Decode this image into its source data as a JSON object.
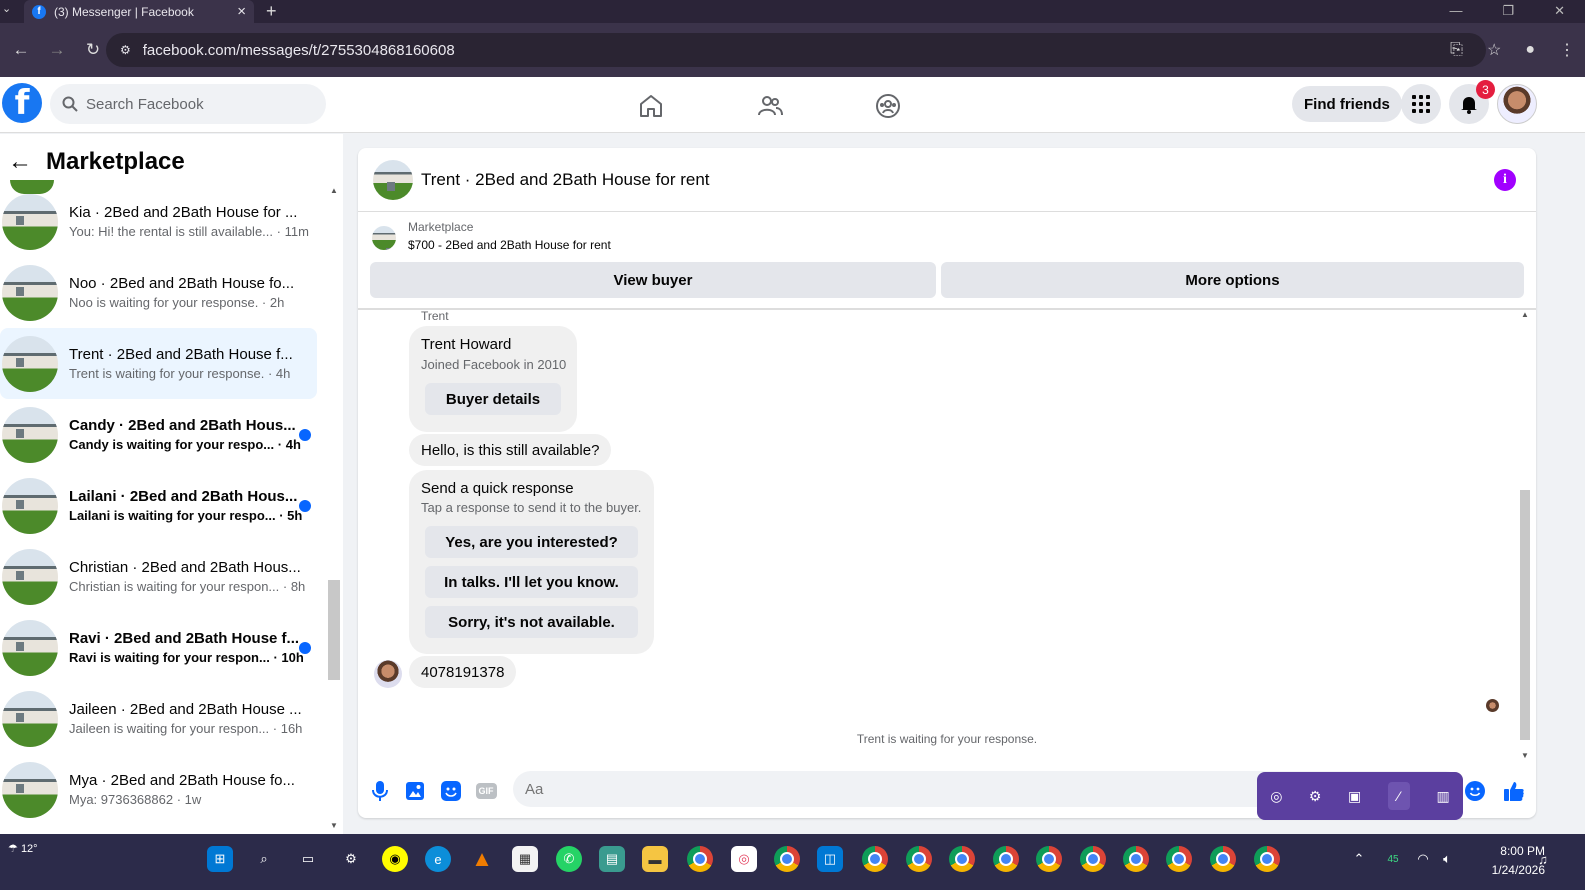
{
  "browser": {
    "tab_title": "(3) Messenger | Facebook",
    "url": "facebook.com/messages/t/2755304868160608"
  },
  "header": {
    "search_placeholder": "Search Facebook",
    "find_friends": "Find friends",
    "notification_count": "3"
  },
  "sidebar": {
    "title": "Marketplace",
    "conversations": [
      {
        "name": "Kia · 2Bed and 2Bath House for ...",
        "preview": "You: Hi! the rental is still available...",
        "time": "11m",
        "unread": false,
        "active": false
      },
      {
        "name": "Noo · 2Bed and 2Bath House fo...",
        "preview": "Noo is waiting for your response.",
        "time": "2h",
        "unread": false,
        "active": false
      },
      {
        "name": "Trent · 2Bed and 2Bath House f...",
        "preview": "Trent is waiting for your response.",
        "time": "4h",
        "unread": false,
        "active": true
      },
      {
        "name": "Candy · 2Bed and 2Bath Hous...",
        "preview": "Candy is waiting for your respo...",
        "time": "4h",
        "unread": true,
        "active": false
      },
      {
        "name": "Lailani · 2Bed and 2Bath Hous...",
        "preview": "Lailani is waiting for your respo...",
        "time": "5h",
        "unread": true,
        "active": false
      },
      {
        "name": "Christian · 2Bed and 2Bath Hous...",
        "preview": "Christian is waiting for your respon...",
        "time": "8h",
        "unread": false,
        "active": false
      },
      {
        "name": "Ravi · 2Bed and 2Bath House f...",
        "preview": "Ravi is waiting for your respon...",
        "time": "10h",
        "unread": true,
        "active": false
      },
      {
        "name": "Jaileen · 2Bed and 2Bath House ...",
        "preview": "Jaileen is waiting for your respon...",
        "time": "16h",
        "unread": false,
        "active": false
      },
      {
        "name": "Mya · 2Bed and 2Bath House fo...",
        "preview": "Mya: 9736368862",
        "time": "1w",
        "unread": false,
        "active": false
      }
    ]
  },
  "chat": {
    "title": "Trent · 2Bed and 2Bath House for rent",
    "listing_label": "Marketplace",
    "listing_desc": "$700 - 2Bed and 2Bath House for rent",
    "view_buyer": "View buyer",
    "more_options": "More options",
    "sender_label": "Trent",
    "buyer_name": "Trent Howard",
    "buyer_joined": "Joined Facebook in 2010",
    "buyer_details": "Buyer details",
    "message_1": "Hello, is this still available?",
    "quick_title": "Send a quick response",
    "quick_sub": "Tap a response to send it to the buyer.",
    "quick_responses": [
      "Yes, are you interested?",
      "In talks. I'll let you know.",
      "Sorry, it's not available."
    ],
    "my_message": "4078191378",
    "waiting_status": "Trent is waiting for your response.",
    "composer_placeholder": "Aa",
    "gif_label": "GIF"
  },
  "taskbar": {
    "temperature": "12°",
    "time": "8:00 PM",
    "date": "1/24/2026",
    "battery": "45"
  },
  "colors": {
    "accent": "#1877f2",
    "unread_dot": "#0866ff",
    "info": "#a100ff",
    "taskbar": "#2c2b4a",
    "browser": "#3b334a"
  }
}
